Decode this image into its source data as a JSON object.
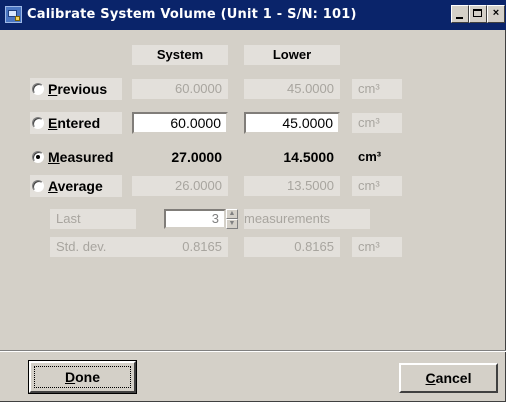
{
  "window": {
    "title": "Calibrate System Volume (Unit 1 - S/N: 101)",
    "buttons": {
      "minimize": "",
      "maximize": "",
      "close": "×"
    }
  },
  "columns": {
    "system": "System",
    "lower": "Lower"
  },
  "rows": {
    "previous": {
      "label_hot": "P",
      "label_rest": "revious",
      "system": "60.0000",
      "lower": "45.0000",
      "unit": "cm³",
      "selected": false
    },
    "entered": {
      "label_hot": "E",
      "label_rest": "ntered",
      "system": "60.0000",
      "lower": "45.0000",
      "unit": "cm³",
      "selected": false
    },
    "measured": {
      "label_hot": "M",
      "label_rest": "easured",
      "system": "27.0000",
      "lower": "14.5000",
      "unit": "cm³",
      "selected": true
    },
    "average": {
      "label_hot": "A",
      "label_rest": "verage",
      "system": "26.0000",
      "lower": "13.5000",
      "unit": "cm³",
      "selected": false
    }
  },
  "last": {
    "label": "Last",
    "value": "3",
    "suffix": "measurements"
  },
  "stddev": {
    "label": "Std. dev.",
    "system": "0.8165",
    "lower": "0.8165",
    "unit": "cm³"
  },
  "footer": {
    "done_hot": "D",
    "done_rest": "one",
    "cancel_hot": "C",
    "cancel_rest": "ancel"
  }
}
